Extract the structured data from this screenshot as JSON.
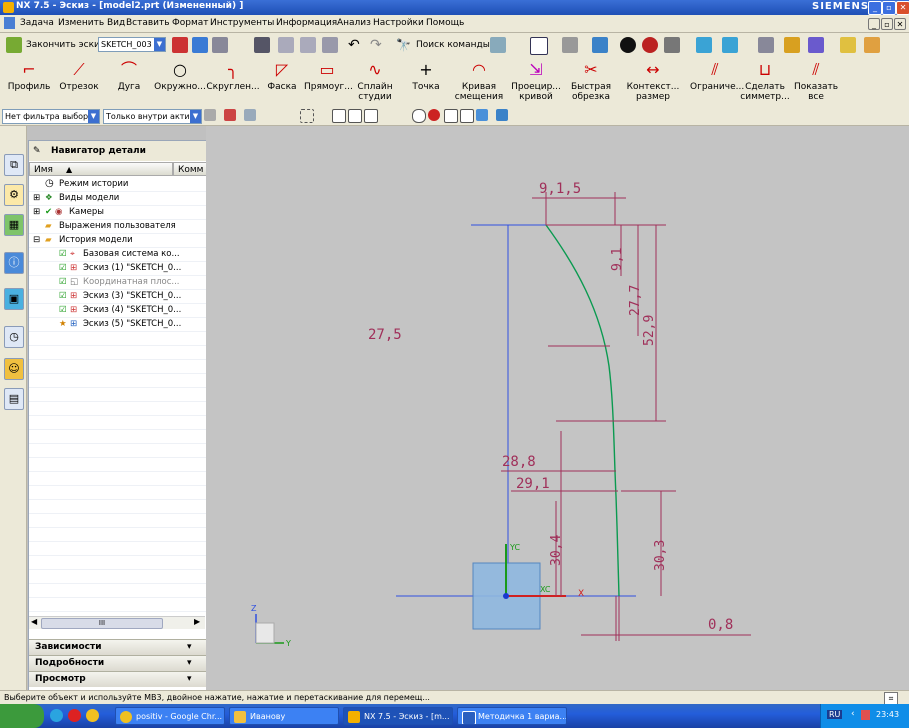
{
  "window": {
    "title": "NX 7.5 - Эскиз - [model2.prt (Измененный) ]",
    "brand": "SIEMENS"
  },
  "menubar": [
    "Задача",
    "Изменить",
    "Вид",
    "Вставить",
    "Формат",
    "Инструменты",
    "Информация",
    "Анализ",
    "Настройки",
    "Помощь"
  ],
  "toolbar1": {
    "finish_sketch": "Закончить эскиз",
    "sketch_name": "SKETCH_003",
    "command_finder": "Поиск команды"
  },
  "toolbar2": [
    "Профиль",
    "Отрезок",
    "Дуга",
    "Окружно...",
    "Скруглен...",
    "Фаска",
    "Прямоуг...",
    "Сплайн студии",
    "Точка",
    "Кривая смещения",
    "Проецир... кривой",
    "Быстрая обрезка",
    "Контекст... размер",
    "Ограниче...",
    "Сделать симметр...",
    "Показать все"
  ],
  "filterbar": {
    "type_filter": "Нет фильтра выбор",
    "scope_filter": "Только внутри актив"
  },
  "navigator": {
    "title": "Навигатор детали",
    "col_name": "Имя",
    "col_comment": "Комм",
    "rows": [
      {
        "label": "Режим истории",
        "dim": false
      },
      {
        "label": "Виды модели",
        "dim": false
      },
      {
        "label": "Камеры",
        "dim": false
      },
      {
        "label": "Выражения пользователя",
        "dim": false
      },
      {
        "label": "История модели",
        "dim": false
      },
      {
        "label": "Базовая система ко...",
        "dim": false
      },
      {
        "label": "Эскиз (1) \"SKETCH_0...",
        "dim": false
      },
      {
        "label": "Координатная плос...",
        "dim": true
      },
      {
        "label": "Эскиз (3) \"SKETCH_0...",
        "dim": false
      },
      {
        "label": "Эскиз (4) \"SKETCH_0...",
        "dim": false
      },
      {
        "label": "Эскиз (5) \"SKETCH_0...",
        "dim": false
      }
    ],
    "scroll_marker": "III",
    "panels": [
      "Зависимости",
      "Подробности",
      "Просмотр"
    ]
  },
  "sketch": {
    "dimensions": [
      "9,1,5",
      "9,1",
      "27,7",
      "52,9",
      "27,5",
      "28,8",
      "29,1",
      "30,4",
      "30,3",
      "0,8"
    ],
    "axis_labels": [
      "YC",
      "XC",
      "X",
      "Y",
      "Z"
    ]
  },
  "status_text": "Выберите объект и используйте МВ3, двойное нажатие, нажатие и перетаскивание для перемещ...",
  "taskbar": {
    "tasks": [
      "positiv - Google Chr...",
      "Иванову",
      "NX 7.5 - Эскиз - [m...",
      "Методичка 1 вариа..."
    ],
    "lang": "RU",
    "clock": "23:43"
  }
}
